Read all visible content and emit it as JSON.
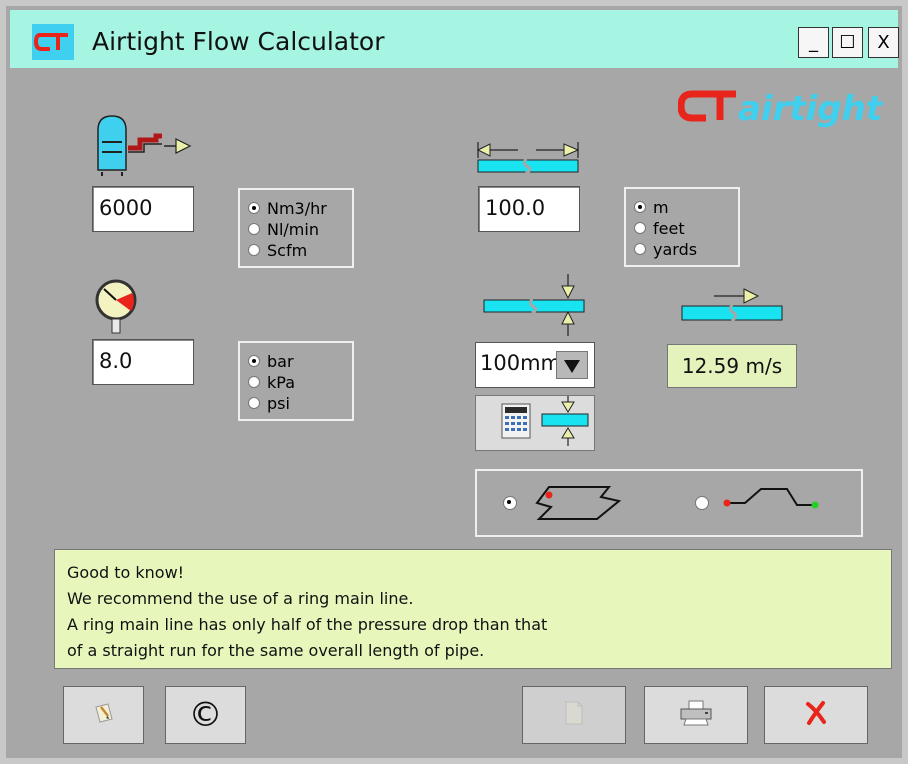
{
  "window": {
    "title": "Airtight Flow Calculator",
    "minimize_label": "_",
    "maximize_label": "☐",
    "close_label": "X"
  },
  "brand": {
    "text": "airtight"
  },
  "flow": {
    "value": "6000",
    "units": [
      "Nm3/hr",
      "Nl/min",
      "Scfm"
    ],
    "selected_index": 0
  },
  "pressure": {
    "value": "8.0",
    "units": [
      "bar",
      "kPa",
      "psi"
    ],
    "selected_index": 0
  },
  "length": {
    "value": "100.0",
    "units": [
      "m",
      "feet",
      "yards"
    ],
    "selected_index": 0
  },
  "pipe_diameter": {
    "selected": "100mm"
  },
  "velocity": {
    "value": "12.59 m/s"
  },
  "layout_option": {
    "selected": "ring-main"
  },
  "info": {
    "lines": [
      "Good to know!",
      "We recommend the use of a ring main line.",
      "A ring main line has only half of the pressure drop than that",
      "of a straight run for the same overall length of pipe."
    ]
  },
  "buttons": {
    "copyright_label": "©"
  },
  "colors": {
    "titlebar": "#a6f4e2",
    "brand_red": "#e8241b",
    "brand_cyan": "#3ed0ee",
    "pipe_cyan": "#19e3f1",
    "info_bg": "#e7f7bc",
    "window_bg": "#a7a7a7"
  }
}
